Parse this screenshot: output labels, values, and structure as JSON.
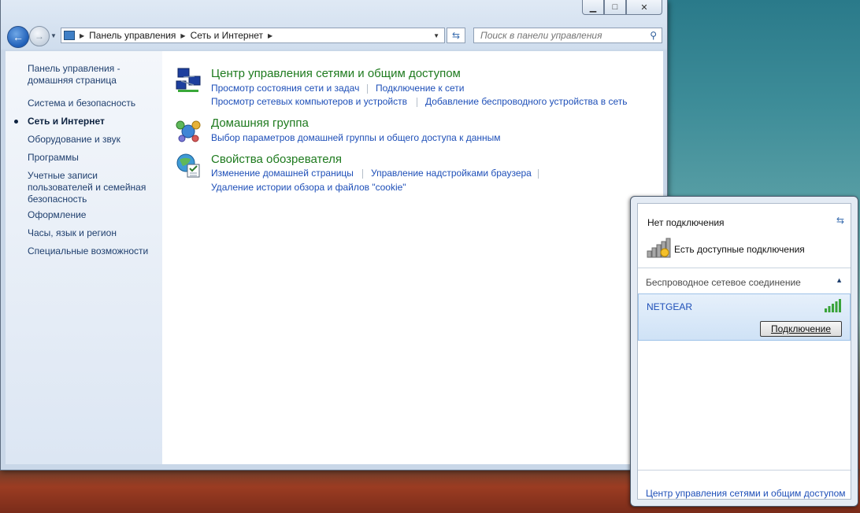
{
  "window": {
    "breadcrumb": [
      "Панель управления",
      "Сеть и Интернет"
    ],
    "search_placeholder": "Поиск в панели управления"
  },
  "sidebar": {
    "items": [
      {
        "label": "Панель управления -",
        "label2": "домашняя страница"
      },
      {
        "label": "Система и безопасность"
      },
      {
        "label": "Сеть и Интернет",
        "active": true
      },
      {
        "label": "Оборудование и звук"
      },
      {
        "label": "Программы"
      },
      {
        "label": "Учетные записи",
        "label2": "пользователей и семейная",
        "label3": "безопасность"
      },
      {
        "label": "Оформление"
      },
      {
        "label": "Часы, язык и регион"
      },
      {
        "label": "Специальные возможности"
      }
    ]
  },
  "content": {
    "groups": [
      {
        "title": "Центр управления сетями и общим доступом",
        "links": [
          "Просмотр состояния сети и задач",
          "Подключение к сети",
          "Просмотр сетевых компьютеров и устройств",
          "Добавление беспроводного устройства в сеть"
        ]
      },
      {
        "title": "Домашняя группа",
        "links": [
          "Выбор параметров домашней группы и общего доступа к данным"
        ]
      },
      {
        "title": "Свойства обозревателя",
        "links": [
          "Изменение домашней страницы",
          "Управление надстройками браузера",
          "Удаление истории обзора и файлов \"cookie\""
        ]
      }
    ]
  },
  "popup": {
    "status": "Нет подключения",
    "available": "Есть доступные подключения",
    "section": "Беспроводное сетевое соединение",
    "network_name": "NETGEAR",
    "connect_label": "Подключение",
    "footer_link": "Центр управления сетями и общим доступом"
  },
  "colors": {
    "link": "#1e4fb8",
    "group_title": "#1e7a1e"
  }
}
